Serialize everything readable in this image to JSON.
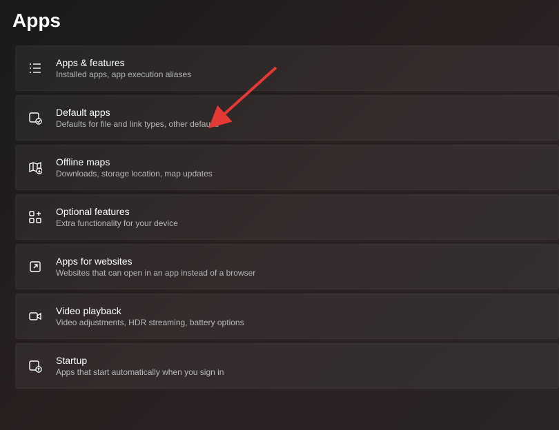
{
  "page": {
    "title": "Apps"
  },
  "items": [
    {
      "title": "Apps & features",
      "subtitle": "Installed apps, app execution aliases"
    },
    {
      "title": "Default apps",
      "subtitle": "Defaults for file and link types, other defaults"
    },
    {
      "title": "Offline maps",
      "subtitle": "Downloads, storage location, map updates"
    },
    {
      "title": "Optional features",
      "subtitle": "Extra functionality for your device"
    },
    {
      "title": "Apps for websites",
      "subtitle": "Websites that can open in an app instead of a browser"
    },
    {
      "title": "Video playback",
      "subtitle": "Video adjustments, HDR streaming, battery options"
    },
    {
      "title": "Startup",
      "subtitle": "Apps that start automatically when you sign in"
    }
  ]
}
